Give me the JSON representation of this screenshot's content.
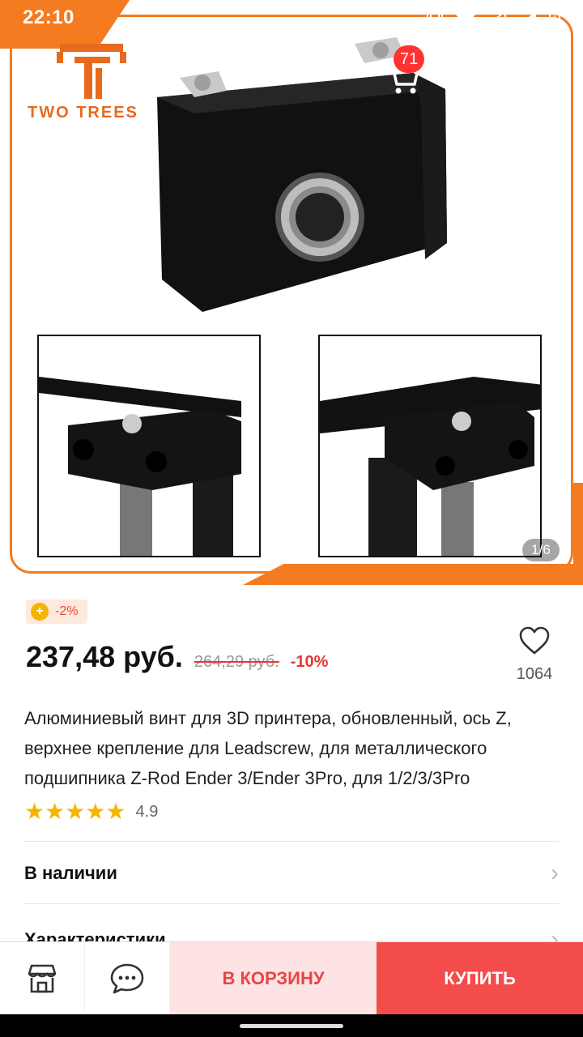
{
  "status_bar": {
    "time": "22:10"
  },
  "header": {
    "cart_count": "71"
  },
  "brand": {
    "logo_text": "TWO TREES"
  },
  "gallery": {
    "counter": "1/6"
  },
  "coupon": {
    "text": "-2%"
  },
  "pricing": {
    "price": "237,48 руб.",
    "old_price": "264,29 руб.",
    "discount": "-10%"
  },
  "favorites": {
    "count": "1064"
  },
  "product": {
    "title": "Алюминиевый винт для 3D принтера, обновленный, ось Z, верхнее крепление для Leadscrew, для металлического подшипника Z-Rod Ender 3/Ender 3Pro, для 1/2/3/3Pro",
    "rating": "4.9",
    "stars": "★★★★★"
  },
  "sections": [
    {
      "label": "В наличии"
    },
    {
      "label": "Характеристики"
    }
  ],
  "bottom_bar": {
    "add_to_cart": "В КОРЗИНУ",
    "buy": "КУПИТЬ"
  },
  "colors": {
    "brand_orange": "#f47b20",
    "accent_red": "#f44b4b",
    "star_yellow": "#f5b400"
  }
}
